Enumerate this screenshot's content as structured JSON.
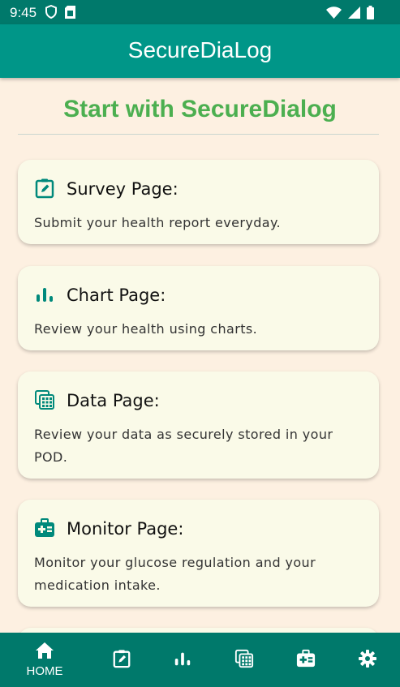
{
  "status_bar": {
    "time": "9:45",
    "icons_left": [
      "shield-icon",
      "sim-card-icon"
    ],
    "icons_right": [
      "wifi-icon",
      "signal-icon",
      "battery-icon"
    ]
  },
  "app_bar": {
    "title": "SecureDiaLog"
  },
  "main": {
    "headline": "Start with SecureDialog",
    "cards": [
      {
        "icon": "survey-clipboard-icon",
        "title": "Survey Page:",
        "description": "Submit your health report everyday."
      },
      {
        "icon": "bar-chart-icon",
        "title": "Chart Page:",
        "description": "Review your health using charts."
      },
      {
        "icon": "data-grid-icon",
        "title": "Data Page:",
        "description": "Review your data as securely stored in your POD."
      },
      {
        "icon": "medical-kit-icon",
        "title": "Monitor Page:",
        "description": "Monitor your glucose regulation and your medication intake."
      }
    ]
  },
  "bottom_nav": {
    "items": [
      {
        "icon": "home-icon",
        "label": "HOME",
        "active": true
      },
      {
        "icon": "survey-clipboard-icon",
        "label": ""
      },
      {
        "icon": "bar-chart-icon",
        "label": ""
      },
      {
        "icon": "data-grid-icon",
        "label": ""
      },
      {
        "icon": "medical-kit-icon",
        "label": ""
      },
      {
        "icon": "settings-gear-icon",
        "label": ""
      }
    ]
  },
  "colors": {
    "status_bar": "#00796b",
    "app_bar": "#009688",
    "background": "#fdf0e1",
    "card": "#fafae8",
    "headline": "#4caf50",
    "icon_teal": "#00897b"
  }
}
